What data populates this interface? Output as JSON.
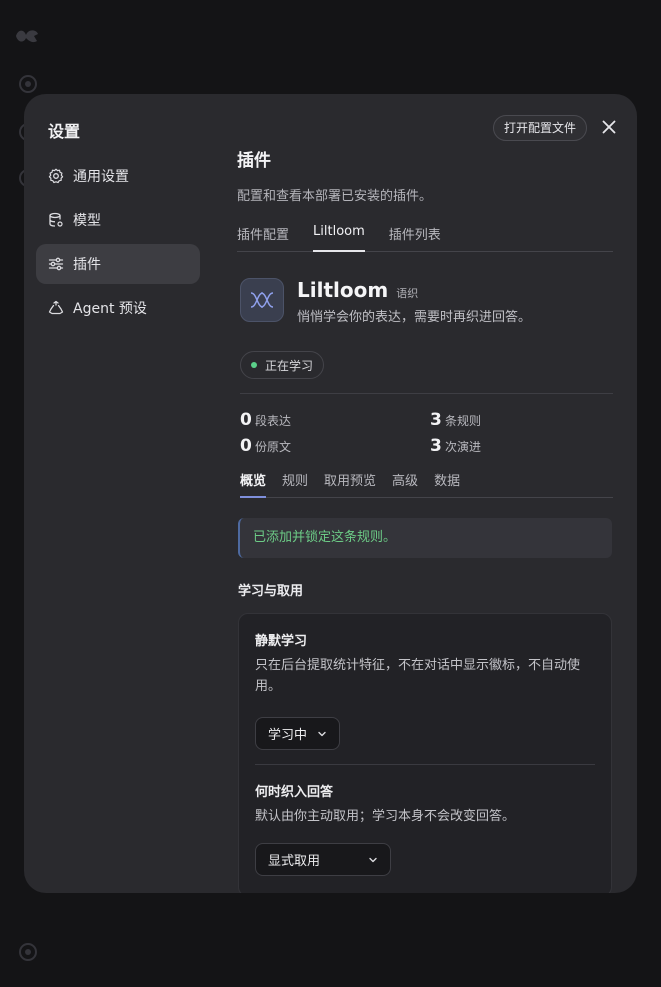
{
  "modal": {
    "title": "设置",
    "open_config_label": "打开配置文件"
  },
  "nav": {
    "items": [
      {
        "label": "通用设置",
        "icon": "gear-icon"
      },
      {
        "label": "模型",
        "icon": "database-icon"
      },
      {
        "label": "插件",
        "icon": "sliders-icon",
        "active": true
      },
      {
        "label": "Agent 预设",
        "icon": "recycle-icon"
      }
    ]
  },
  "page": {
    "title": "插件",
    "description": "配置和查看本部署已安装的插件。"
  },
  "tabs": [
    {
      "label": "插件配置"
    },
    {
      "label": "Liltloom",
      "active": true
    },
    {
      "label": "插件列表"
    }
  ],
  "plugin": {
    "name": "Liltloom",
    "tag": "语织",
    "subtitle": "悄悄学会你的表达，需要时再织进回答。",
    "status": "正在学习",
    "accent": "#7f8fdc",
    "status_color": "#5bd08a"
  },
  "stats": [
    {
      "value": "0",
      "label": "段表达"
    },
    {
      "value": "3",
      "label": "条规则"
    },
    {
      "value": "0",
      "label": "份原文"
    },
    {
      "value": "3",
      "label": "次演进"
    }
  ],
  "subtabs": [
    {
      "label": "概览",
      "active": true
    },
    {
      "label": "规则"
    },
    {
      "label": "取用预览"
    },
    {
      "label": "高级"
    },
    {
      "label": "数据"
    }
  ],
  "notice": "已添加并锁定这条规则。",
  "section": {
    "title": "学习与取用",
    "fields": [
      {
        "title": "静默学习",
        "description": "只在后台提取统计特征，不在对话中显示徽标，不自动使用。",
        "value": "学习中"
      },
      {
        "title": "何时织入回答",
        "description": "默认由你主动取用；学习本身不会改变回答。",
        "value": "显式取用"
      }
    ]
  }
}
